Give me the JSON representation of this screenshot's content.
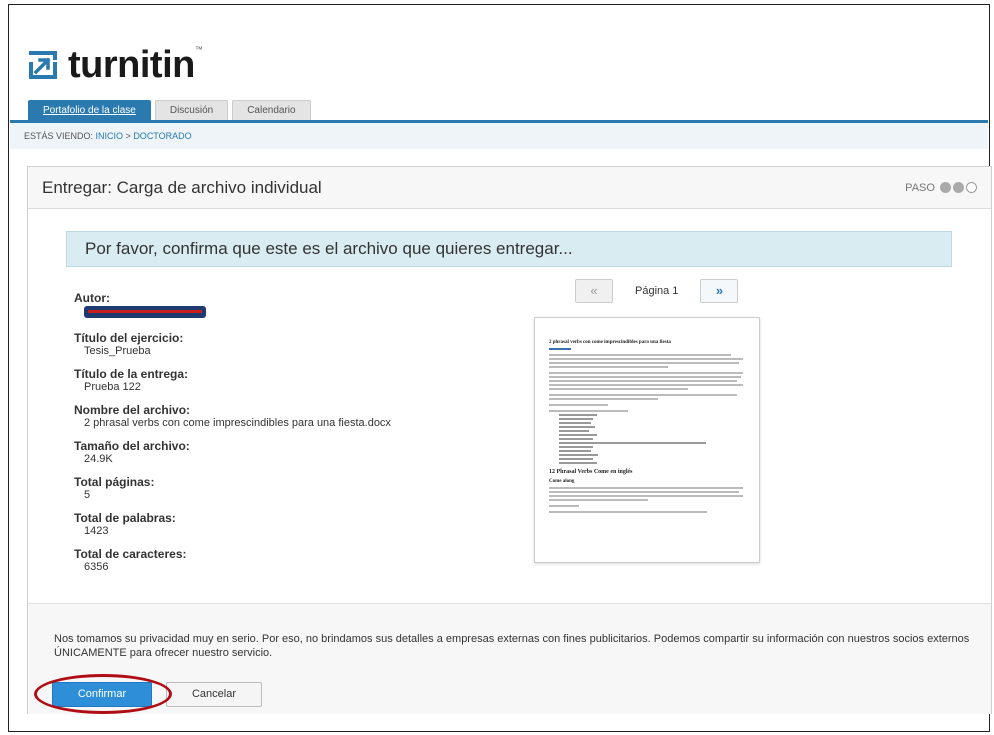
{
  "app": {
    "logo_text": "turnitin",
    "logo_tm": "™",
    "brand_color": "#2a7ab0"
  },
  "tabs": [
    {
      "label": "Portafolio de la clase",
      "active": true
    },
    {
      "label": "Discusión",
      "active": false
    },
    {
      "label": "Calendario",
      "active": false
    }
  ],
  "breadcrumb": {
    "prefix": "ESTÁS VIENDO: ",
    "home": "INICIO",
    "separator": " > ",
    "current": "DOCTORADO"
  },
  "panel": {
    "title": "Entregar: Carga de archivo individual",
    "step_label": "PASO",
    "step_current": 2,
    "step_total": 3,
    "banner": "Por favor, confirma que este es el archivo que quieres entregar..."
  },
  "meta": {
    "author_label": "Autor:",
    "assignment_label": "Título del ejercicio:",
    "assignment_value": "Tesis_Prueba",
    "submission_label": "Título de la entrega:",
    "submission_value": "Prueba 122",
    "filename_label": "Nombre del archivo:",
    "filename_value": "2 phrasal verbs con come imprescindibles para una fiesta.docx",
    "filesize_label": "Tamaño del archivo:",
    "filesize_value": "24.9K",
    "pages_label": "Total páginas:",
    "pages_value": "5",
    "words_label": "Total de palabras:",
    "words_value": "1423",
    "chars_label": "Total de caracteres:",
    "chars_value": "6356"
  },
  "pager": {
    "prev": "«",
    "label": "Página 1",
    "next": "»"
  },
  "preview": {
    "title": "2 phrasal verbs con come imprescindibles para una fiesta",
    "heading2": "12 Phrasal Verbs Come en inglés",
    "heading3": "Come along"
  },
  "footer": {
    "privacy": "Nos tomamos su privacidad muy en serio. Por eso, no brindamos sus detalles a empresas externas con fines publicitarios. Podemos compartir su información con nuestros socios externos ÚNICAMENTE para ofrecer nuestro servicio.",
    "confirm": "Confirmar",
    "cancel": "Cancelar",
    "highlight_color": "#b00e15"
  }
}
